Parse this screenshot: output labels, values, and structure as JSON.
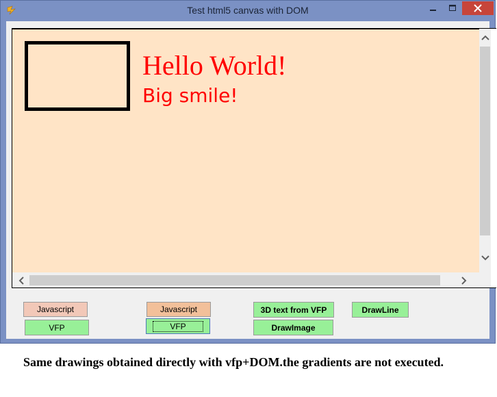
{
  "window": {
    "title": "Test html5 canvas with DOM"
  },
  "canvas": {
    "heading_text": "Hello World!",
    "subheading_text": "Big smile!",
    "background_color": "#ffe4c6",
    "text_color": "#ff0000"
  },
  "buttons": {
    "javascript_1": "Javascript",
    "vfp_1": "VFP",
    "javascript_2": "Javascript",
    "vfp_2": "VFP",
    "text3d": "3D text from VFP",
    "drawimage": "DrawImage",
    "drawline": "DrawLine"
  },
  "caption": "Same drawings obtained directly with vfp+DOM.the gradients are not executed.",
  "colors": {
    "frame": "#7b91c4",
    "close": "#c7453a",
    "button_salmon": "#f2c8b8",
    "button_peach": "#f2c09a",
    "button_green": "#98f098"
  }
}
